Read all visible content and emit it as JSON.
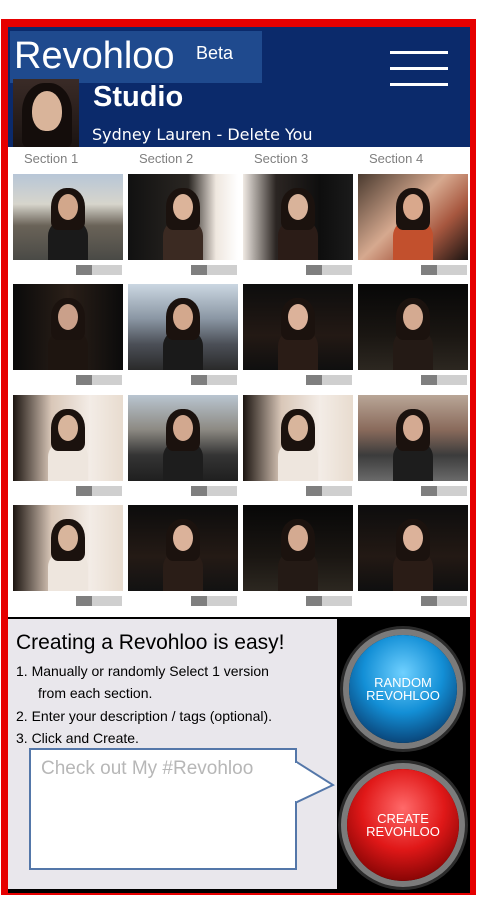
{
  "header": {
    "brand": "Revohloo",
    "beta": "Beta",
    "title": "Studio",
    "track": "Sydney Lauren - Delete You"
  },
  "sections": [
    "Section 1",
    "Section 2",
    "Section 3",
    "Section 4"
  ],
  "rows": [
    [
      {
        "bg": "linear-gradient(180deg,#b7c6d7 0%,#d7d5cc 35%,#6a6358 60%,#4a4a46 100%)",
        "fig": "#1a1a1a",
        "skin": "#d2a78b"
      },
      {
        "bg": "linear-gradient(90deg,#111 0%,#2a2622 55%,#efe7df 80%,#fff 100%)",
        "fig": "#3b2a22",
        "skin": "#dcb49a"
      },
      {
        "bg": "linear-gradient(90deg,#f0eae4 0%,#2b2522 30%,#0e0e0e 70%,#1b1b1b 100%)",
        "fig": "#2b1c17",
        "skin": "#d9b39a"
      },
      {
        "bg": "linear-gradient(135deg,#4a3a2f 0%,#d6a98f 45%,#a7573f 70%,#1a1412 100%)",
        "fig": "#c2502d",
        "skin": "#d9a88c"
      }
    ],
    [
      {
        "bg": "linear-gradient(90deg,#0a0a0a 0%,#2a1f18 50%,#0b0b0b 100%)",
        "fig": "#1e1510",
        "skin": "#caa08a"
      },
      {
        "bg": "linear-gradient(180deg,#cbd7e2 0%,#8b97a4 40%,#4b4f57 70%,#2a2a2a 100%)",
        "fig": "#1a1a1a",
        "skin": "#d3a88d"
      },
      {
        "bg": "linear-gradient(180deg,#0d0d0d 0%,#231914 60%,#0f0f0f 100%)",
        "fig": "#2a1c16",
        "skin": "#dcb29a"
      },
      {
        "bg": "linear-gradient(180deg,#070707 0%,#1a1612 60%,#2c2720 100%)",
        "fig": "#241a15",
        "skin": "#d4aa91"
      }
    ],
    [
      {
        "bg": "linear-gradient(90deg,#1b1410 0%,#d9c7b8 35%,#f3ece6 70%,#e8dccf 100%)",
        "fig": "#eee6de",
        "skin": "#d8b59c"
      },
      {
        "bg": "linear-gradient(180deg,#b9c5d0 0%,#8d8a83 40%,#343434 70%,#1f1f1f 100%)",
        "fig": "#1d1d1d",
        "skin": "#d2a88f"
      },
      {
        "bg": "linear-gradient(90deg,#1b1410 0%,#d9c7b8 35%,#f3ece6 70%,#e8dccf 100%)",
        "fig": "#eee6de",
        "skin": "#d8b59c"
      },
      {
        "bg": "linear-gradient(180deg,#b9a697 0%,#8a6b5c 40%,#3c3c3c 70%,#6a6a6a 100%)",
        "fig": "#1d1d1d",
        "skin": "#d4aa92"
      }
    ],
    [
      {
        "bg": "linear-gradient(90deg,#1b1410 0%,#d9c7b8 35%,#f3ece6 70%,#e8dccf 100%)",
        "fig": "#eee6de",
        "skin": "#d8b59c"
      },
      {
        "bg": "linear-gradient(180deg,#0c0c0c 0%,#241a15 60%,#121212 100%)",
        "fig": "#2a1d17",
        "skin": "#dbb29a"
      },
      {
        "bg": "linear-gradient(180deg,#070707 0%,#1a1612 60%,#2c2720 100%)",
        "fig": "#241a15",
        "skin": "#d4aa91"
      },
      {
        "bg": "linear-gradient(180deg,#0d0d0d 0%,#231914 60%,#0f0f0f 100%)",
        "fig": "#2a1c16",
        "skin": "#dcb29a"
      }
    ]
  ],
  "info": {
    "title": "Creating a Revohloo is easy!",
    "step1a": "1. Manually or randomly  Select 1 version",
    "step1b": "from each section.",
    "step2": "2. Enter your description / tags (optional).",
    "step3": "3. Click and Create.",
    "placeholder": "Check out My #Revohloo"
  },
  "buttons": {
    "random_line1": "RANDOM",
    "random_line2": "REVOHLOO",
    "create_line1": "CREATE",
    "create_line2": "REVOHLOO"
  },
  "colors": {
    "header": "#0b2a6b",
    "frame": "#e60000",
    "toggle_track": "#cfcfcf",
    "toggle_knob": "#7f7f7f"
  }
}
